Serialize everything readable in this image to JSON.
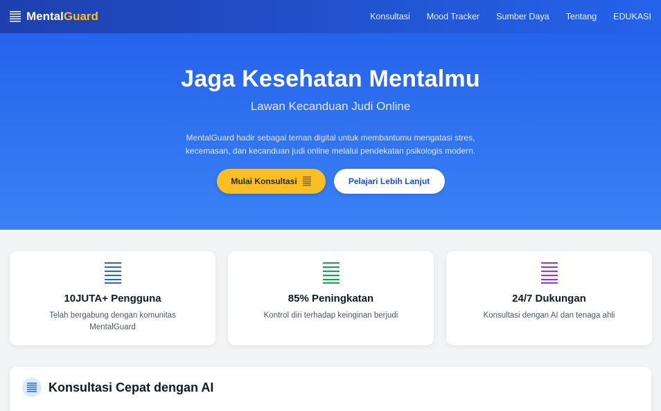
{
  "brand": {
    "part1": "Mental",
    "part2": "Guard"
  },
  "nav": [
    "Konsultasi",
    "Mood Tracker",
    "Sumber Daya",
    "Tentang",
    "EDUKASI"
  ],
  "hero": {
    "title": "Jaga Kesehatan Mentalmu",
    "subtitle": "Lawan Kecanduan Judi Online",
    "description": "MentalGuard hadir sebagai teman digital untuk membantumu mengatasi stres, kecemasan, dan kecanduan judi online melalui pendekatan psikologis modern.",
    "primary_button": "Mulai Konsultasi",
    "secondary_button": "Pelajari Lebih Lanjut"
  },
  "stats": [
    {
      "title": "10JUTA+ Pengguna",
      "text": "Telah bergabung dengan komunitas MentalGuard",
      "color": "#2563eb"
    },
    {
      "title": "85% Peningkatan",
      "text": "Kontrol diri terhadap keinginan berjudi",
      "color": "#16a34a"
    },
    {
      "title": "24/7 Dukungan",
      "text": "Konsultasi dengan AI dan tenaga ahli",
      "color": "#9333ea"
    }
  ],
  "ai_section": {
    "title": "Konsultasi Cepat dengan AI"
  },
  "colors": {
    "accent": "#fbbf24",
    "primary": "#2563eb"
  }
}
